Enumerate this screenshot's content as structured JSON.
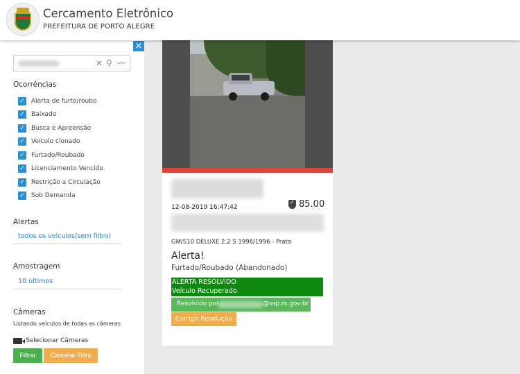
{
  "header": {
    "title": "Cercamento Eletrônico",
    "subtitle": "PREFEITURA DE PORTO ALEGRE"
  },
  "sidebar": {
    "close_label": "×",
    "search": {
      "value": "",
      "placeholder": ""
    },
    "ocorrencias": {
      "title": "Ocorrências",
      "items": [
        {
          "label": "Alerta de furto/roubo",
          "checked": true
        },
        {
          "label": "Baixado",
          "checked": true
        },
        {
          "label": "Busca e Apreensão",
          "checked": true
        },
        {
          "label": "Veículo clonado",
          "checked": true
        },
        {
          "label": "Furtado/Roubado",
          "checked": true
        },
        {
          "label": "Licenciamento Vencido",
          "checked": true
        },
        {
          "label": "Restrição a Circulação",
          "checked": true
        },
        {
          "label": "Sob Demanda",
          "checked": true
        }
      ]
    },
    "alertas": {
      "title": "Alertas",
      "value": "todos os veículos(sem filtro)"
    },
    "amostragem": {
      "title": "Amostragem",
      "value": "10 últimos"
    },
    "cameras": {
      "title": "Câmeras",
      "description": "Listando veículos de todas as câmeras",
      "select_label": "Selecionar Câmeras"
    },
    "filter_label": "Filtrar",
    "cancel_filter_label": "Cancelar Filtro"
  },
  "card": {
    "datetime": "12-08-2019 16:47:42",
    "score": "85.00",
    "vehicle": "GM/S10 DELUXE 2.2 S 1996/1996 - Prata",
    "alert_title": "Alerta!",
    "alert_subtitle": "Furtado/Roubado (Abandonado)",
    "status_line1": "ALERTA RESOLVIDO",
    "status_line2": "Veículo Recuperado",
    "resolved_by_prefix": "Resolvido por",
    "resolved_by_suffix": "@ssp.rs.gov.br",
    "fix_label": "Corrigir Resolução"
  },
  "colors": {
    "accent_blue": "#2a8fd6",
    "alert_red": "#d9463a",
    "resolved_green": "#0d8a0d",
    "button_green": "#4cae4c",
    "button_orange": "#f0ad4e"
  }
}
